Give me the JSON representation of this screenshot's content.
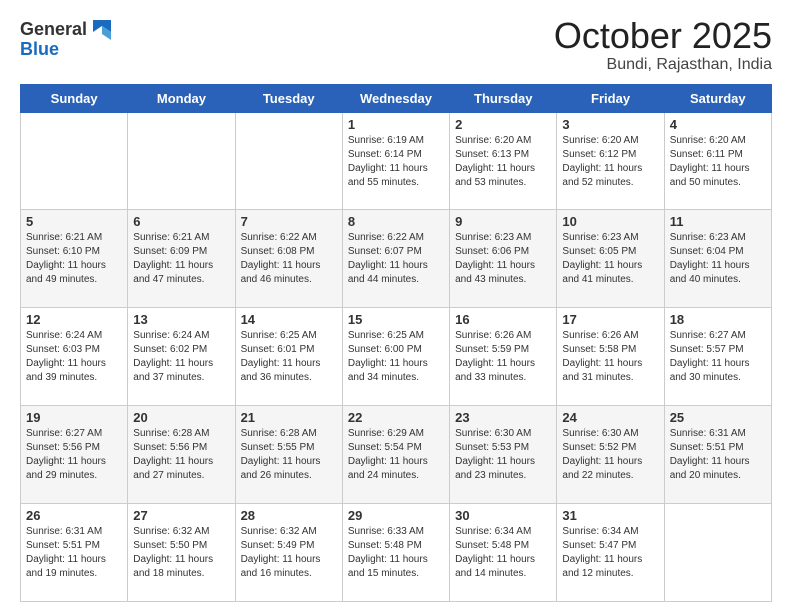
{
  "header": {
    "logo_general": "General",
    "logo_blue": "Blue",
    "title": "October 2025",
    "location": "Bundi, Rajasthan, India"
  },
  "days_of_week": [
    "Sunday",
    "Monday",
    "Tuesday",
    "Wednesday",
    "Thursday",
    "Friday",
    "Saturday"
  ],
  "weeks": [
    [
      {
        "day": "",
        "sunrise": "",
        "sunset": "",
        "daylight": ""
      },
      {
        "day": "",
        "sunrise": "",
        "sunset": "",
        "daylight": ""
      },
      {
        "day": "",
        "sunrise": "",
        "sunset": "",
        "daylight": ""
      },
      {
        "day": "1",
        "sunrise": "Sunrise: 6:19 AM",
        "sunset": "Sunset: 6:14 PM",
        "daylight": "Daylight: 11 hours and 55 minutes."
      },
      {
        "day": "2",
        "sunrise": "Sunrise: 6:20 AM",
        "sunset": "Sunset: 6:13 PM",
        "daylight": "Daylight: 11 hours and 53 minutes."
      },
      {
        "day": "3",
        "sunrise": "Sunrise: 6:20 AM",
        "sunset": "Sunset: 6:12 PM",
        "daylight": "Daylight: 11 hours and 52 minutes."
      },
      {
        "day": "4",
        "sunrise": "Sunrise: 6:20 AM",
        "sunset": "Sunset: 6:11 PM",
        "daylight": "Daylight: 11 hours and 50 minutes."
      }
    ],
    [
      {
        "day": "5",
        "sunrise": "Sunrise: 6:21 AM",
        "sunset": "Sunset: 6:10 PM",
        "daylight": "Daylight: 11 hours and 49 minutes."
      },
      {
        "day": "6",
        "sunrise": "Sunrise: 6:21 AM",
        "sunset": "Sunset: 6:09 PM",
        "daylight": "Daylight: 11 hours and 47 minutes."
      },
      {
        "day": "7",
        "sunrise": "Sunrise: 6:22 AM",
        "sunset": "Sunset: 6:08 PM",
        "daylight": "Daylight: 11 hours and 46 minutes."
      },
      {
        "day": "8",
        "sunrise": "Sunrise: 6:22 AM",
        "sunset": "Sunset: 6:07 PM",
        "daylight": "Daylight: 11 hours and 44 minutes."
      },
      {
        "day": "9",
        "sunrise": "Sunrise: 6:23 AM",
        "sunset": "Sunset: 6:06 PM",
        "daylight": "Daylight: 11 hours and 43 minutes."
      },
      {
        "day": "10",
        "sunrise": "Sunrise: 6:23 AM",
        "sunset": "Sunset: 6:05 PM",
        "daylight": "Daylight: 11 hours and 41 minutes."
      },
      {
        "day": "11",
        "sunrise": "Sunrise: 6:23 AM",
        "sunset": "Sunset: 6:04 PM",
        "daylight": "Daylight: 11 hours and 40 minutes."
      }
    ],
    [
      {
        "day": "12",
        "sunrise": "Sunrise: 6:24 AM",
        "sunset": "Sunset: 6:03 PM",
        "daylight": "Daylight: 11 hours and 39 minutes."
      },
      {
        "day": "13",
        "sunrise": "Sunrise: 6:24 AM",
        "sunset": "Sunset: 6:02 PM",
        "daylight": "Daylight: 11 hours and 37 minutes."
      },
      {
        "day": "14",
        "sunrise": "Sunrise: 6:25 AM",
        "sunset": "Sunset: 6:01 PM",
        "daylight": "Daylight: 11 hours and 36 minutes."
      },
      {
        "day": "15",
        "sunrise": "Sunrise: 6:25 AM",
        "sunset": "Sunset: 6:00 PM",
        "daylight": "Daylight: 11 hours and 34 minutes."
      },
      {
        "day": "16",
        "sunrise": "Sunrise: 6:26 AM",
        "sunset": "Sunset: 5:59 PM",
        "daylight": "Daylight: 11 hours and 33 minutes."
      },
      {
        "day": "17",
        "sunrise": "Sunrise: 6:26 AM",
        "sunset": "Sunset: 5:58 PM",
        "daylight": "Daylight: 11 hours and 31 minutes."
      },
      {
        "day": "18",
        "sunrise": "Sunrise: 6:27 AM",
        "sunset": "Sunset: 5:57 PM",
        "daylight": "Daylight: 11 hours and 30 minutes."
      }
    ],
    [
      {
        "day": "19",
        "sunrise": "Sunrise: 6:27 AM",
        "sunset": "Sunset: 5:56 PM",
        "daylight": "Daylight: 11 hours and 29 minutes."
      },
      {
        "day": "20",
        "sunrise": "Sunrise: 6:28 AM",
        "sunset": "Sunset: 5:56 PM",
        "daylight": "Daylight: 11 hours and 27 minutes."
      },
      {
        "day": "21",
        "sunrise": "Sunrise: 6:28 AM",
        "sunset": "Sunset: 5:55 PM",
        "daylight": "Daylight: 11 hours and 26 minutes."
      },
      {
        "day": "22",
        "sunrise": "Sunrise: 6:29 AM",
        "sunset": "Sunset: 5:54 PM",
        "daylight": "Daylight: 11 hours and 24 minutes."
      },
      {
        "day": "23",
        "sunrise": "Sunrise: 6:30 AM",
        "sunset": "Sunset: 5:53 PM",
        "daylight": "Daylight: 11 hours and 23 minutes."
      },
      {
        "day": "24",
        "sunrise": "Sunrise: 6:30 AM",
        "sunset": "Sunset: 5:52 PM",
        "daylight": "Daylight: 11 hours and 22 minutes."
      },
      {
        "day": "25",
        "sunrise": "Sunrise: 6:31 AM",
        "sunset": "Sunset: 5:51 PM",
        "daylight": "Daylight: 11 hours and 20 minutes."
      }
    ],
    [
      {
        "day": "26",
        "sunrise": "Sunrise: 6:31 AM",
        "sunset": "Sunset: 5:51 PM",
        "daylight": "Daylight: 11 hours and 19 minutes."
      },
      {
        "day": "27",
        "sunrise": "Sunrise: 6:32 AM",
        "sunset": "Sunset: 5:50 PM",
        "daylight": "Daylight: 11 hours and 18 minutes."
      },
      {
        "day": "28",
        "sunrise": "Sunrise: 6:32 AM",
        "sunset": "Sunset: 5:49 PM",
        "daylight": "Daylight: 11 hours and 16 minutes."
      },
      {
        "day": "29",
        "sunrise": "Sunrise: 6:33 AM",
        "sunset": "Sunset: 5:48 PM",
        "daylight": "Daylight: 11 hours and 15 minutes."
      },
      {
        "day": "30",
        "sunrise": "Sunrise: 6:34 AM",
        "sunset": "Sunset: 5:48 PM",
        "daylight": "Daylight: 11 hours and 14 minutes."
      },
      {
        "day": "31",
        "sunrise": "Sunrise: 6:34 AM",
        "sunset": "Sunset: 5:47 PM",
        "daylight": "Daylight: 11 hours and 12 minutes."
      },
      {
        "day": "",
        "sunrise": "",
        "sunset": "",
        "daylight": ""
      }
    ]
  ]
}
